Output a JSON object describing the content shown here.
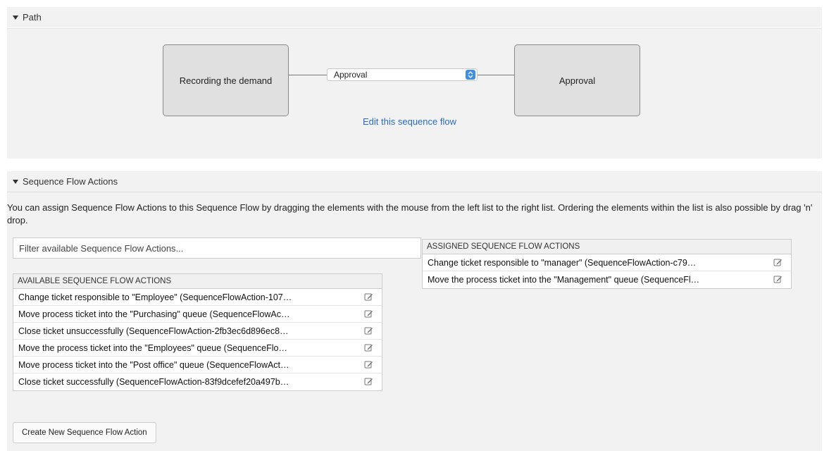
{
  "path_section": {
    "title": "Path",
    "left_node": "Recording the demand",
    "right_node": "Approval",
    "transition_select": "Approval",
    "edit_link": "Edit this sequence flow"
  },
  "actions_section": {
    "title": "Sequence Flow Actions",
    "description": "You can assign Sequence Flow Actions to this Sequence Flow by dragging the elements with the mouse from the left list to the right list. Ordering the elements within the list is also possible by drag 'n' drop.",
    "filter_placeholder": "Filter available Sequence Flow Actions...",
    "available": {
      "header": "AVAILABLE SEQUENCE FLOW ACTIONS",
      "items": [
        "Change ticket responsible to \"Employee\" (SequenceFlowAction-107…",
        "Move process ticket into the \"Purchasing\" queue (SequenceFlowAc…",
        "Close ticket unsuccessfully (SequenceFlowAction-2fb3ec6d896ec8…",
        "Move the process ticket into the \"Employees\" queue (SequenceFlo…",
        "Move process ticket into the \"Post office\" queue (SequenceFlowAct…",
        "Close ticket successfully (SequenceFlowAction-83f9dcefef20a497b…"
      ]
    },
    "assigned": {
      "header": "ASSIGNED SEQUENCE FLOW ACTIONS",
      "items": [
        "Change ticket responsible to \"manager\" (SequenceFlowAction-c79…",
        "Move the process ticket into the \"Management\" queue (SequenceFl…"
      ]
    },
    "create_button": "Create New Sequence Flow Action"
  },
  "icons": {
    "collapse": "triangle-down-icon",
    "edit": "edit-icon",
    "select_arrows": "select-arrows-icon"
  }
}
